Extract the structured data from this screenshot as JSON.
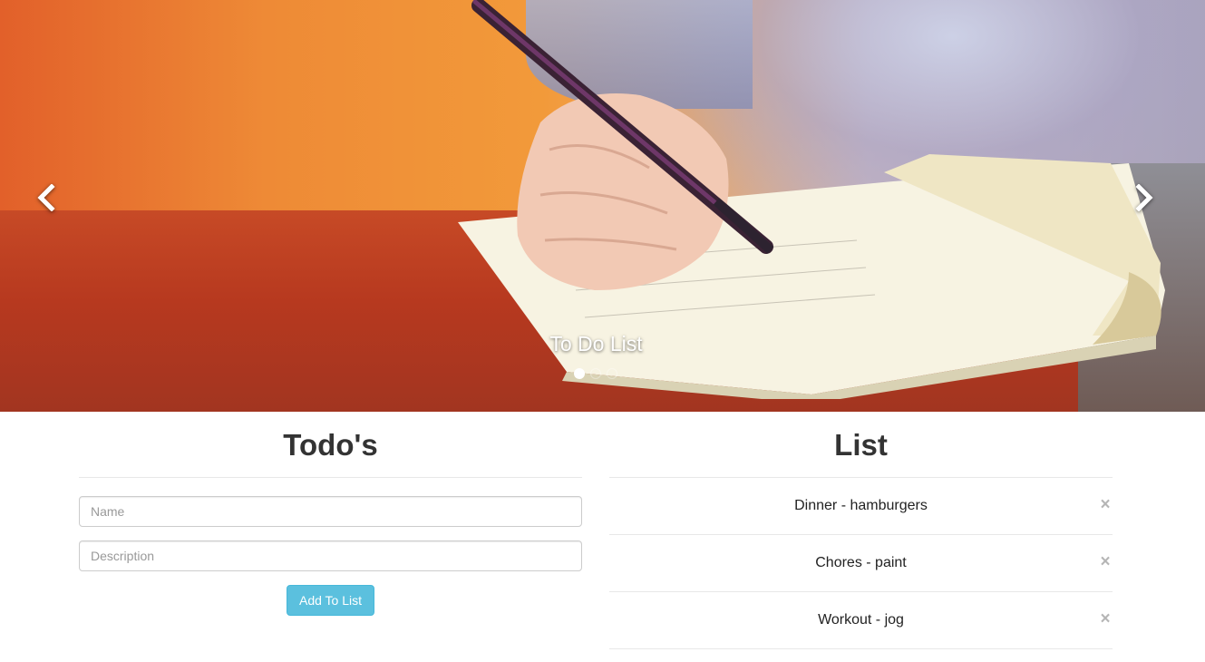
{
  "carousel": {
    "caption": "To Do List",
    "prev_icon": "chevron-left-icon",
    "next_icon": "chevron-right-icon",
    "indicator_count": 3,
    "active_indicator": 1
  },
  "todos": {
    "title": "Todo's",
    "name_placeholder": "Name",
    "name_value": "",
    "description_placeholder": "Description",
    "description_value": "",
    "add_button_label": "Add To List",
    "add_button_color": "#5bc0de"
  },
  "list": {
    "title": "List",
    "remove_icon": "close-icon",
    "items": [
      {
        "text": "Dinner - hamburgers"
      },
      {
        "text": "Chores - paint"
      },
      {
        "text": "Workout - jog"
      }
    ]
  }
}
